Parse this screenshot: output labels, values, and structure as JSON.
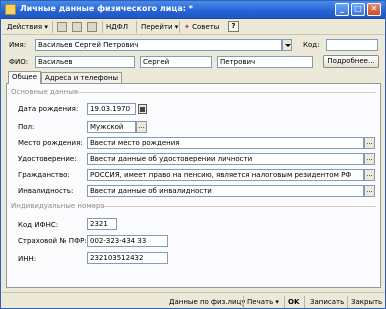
{
  "window": {
    "title": "Личные данные физического лица: *",
    "min_label": "_",
    "max_label": "□",
    "close_label": "✕"
  },
  "toolbar": {
    "actions_label": "Действия",
    "ndfl_label": "НДФЛ",
    "goto_label": "Перейти",
    "tips_label": "Советы",
    "help_label": "?"
  },
  "form": {
    "name_label": "Имя:",
    "name_value": "Васильев Сергей Петрович",
    "code_label": "Код:",
    "code_value": "",
    "fio_label": "ФИО:",
    "last_name": "Васильев",
    "first_name": "Сергей",
    "middle_name": "Петрович",
    "more_button": "Подробнее..."
  },
  "tabs": [
    {
      "label": "Общее",
      "active": true
    },
    {
      "label": "Адреса и телефоны",
      "active": false
    }
  ],
  "basic": {
    "section_title": "Основные данные",
    "birth_date_label": "Дата рождения:",
    "birth_date_value": "19.03.1970",
    "sex_label": "Пол:",
    "sex_value": "Мужской",
    "birthplace_label": "Место рождения:",
    "birthplace_value": "Ввести место рождения",
    "id_label": "Удостоверение:",
    "id_value": "Ввести данные об удостоверении личности",
    "citizenship_label": "Гражданство:",
    "citizenship_value": "РОССИЯ, имеет право на пенсию, является налоговым резидентом РФ",
    "disability_label": "Инвалидность:",
    "disability_value": "Ввести данные об инвалидности"
  },
  "individual": {
    "section_title": "Индивидуальные номера",
    "ifns_label": "Код ИФНС:",
    "ifns_value": "2321",
    "pfr_label": "Страховой № ПФР:",
    "pfr_value": "002-323-434 33",
    "inn_label": "ИНН:",
    "inn_value": "232103512432"
  },
  "bottom": {
    "individual_data": "Данные по физ.лицу",
    "print": "Печать",
    "ok": "OK",
    "save": "Записать",
    "close": "Закрыть"
  }
}
